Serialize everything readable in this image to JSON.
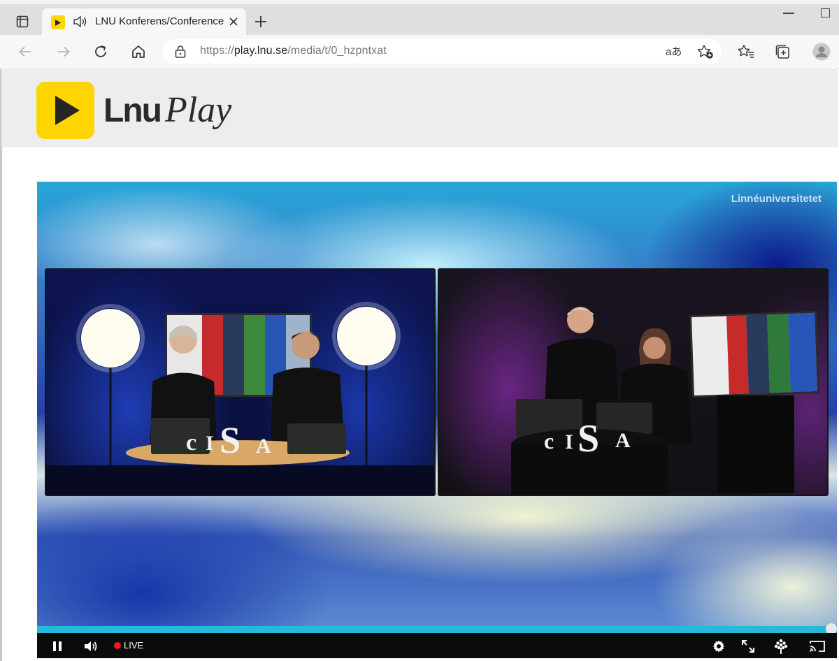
{
  "browser": {
    "tab": {
      "title": "LNU Konferens/Conference"
    },
    "address_bar": {
      "url_prefix": "https://",
      "url_host": "play.lnu.se",
      "url_path": "/media/t/0_hzpntxat",
      "read_aloud_glyph": "aあ"
    },
    "icons": [
      "tab-actions-icon",
      "speaker-icon",
      "close-icon",
      "plus-icon",
      "back-icon",
      "forward-icon",
      "refresh-icon",
      "home-icon",
      "lock-icon",
      "read-aloud-icon",
      "add-favorite-icon",
      "favorites-icon",
      "collections-icon",
      "profile-icon"
    ]
  },
  "site": {
    "logo_text_bold": "Lnu",
    "logo_text_italic": "Play"
  },
  "player": {
    "watermark": "Linnéuniversitetet",
    "live_label": "LIVE",
    "progress": 1.0,
    "accent_color": "#28b8da"
  }
}
